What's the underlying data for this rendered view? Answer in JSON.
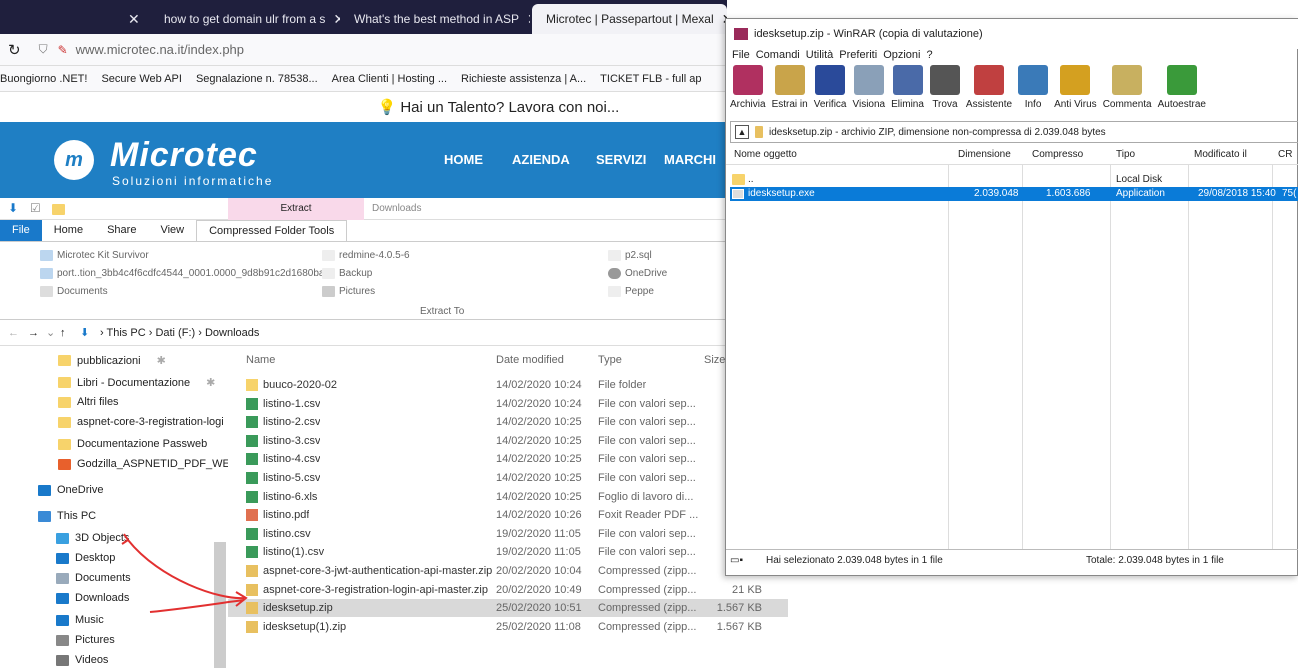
{
  "browser": {
    "tabs": [
      {
        "label": "how to get domain ulr from a s"
      },
      {
        "label": "What's the best method in ASP"
      },
      {
        "label": "Microtec | Passepartout | Mexal"
      }
    ],
    "url": "www.microtec.na.it/index.php",
    "bookmarks": [
      "Buongiorno .NET!",
      "Secure Web API",
      "Segnalazione n. 78538...",
      "Area Clienti | Hosting ...",
      "Richieste assistenza | A...",
      "TICKET FLB - full ap"
    ]
  },
  "site": {
    "banner": "Hai un Talento? Lavora con noi...",
    "logo_mark": "m",
    "logo_text": "Microtec",
    "logo_sub": "Soluzioni informatiche",
    "nav": [
      "HOME",
      "AZIENDA",
      "SERVIZI",
      "MARCHI"
    ]
  },
  "explorer": {
    "ribbon_top": {
      "extract": "Extract",
      "downloads": "Downloads"
    },
    "tabs": [
      "File",
      "Home",
      "Share",
      "View",
      "Compressed Folder Tools"
    ],
    "ribbon_items": [
      "Microtec Kit Survivor",
      "port..tion_3bb4c4f6cdfc4544_0001.0000_9d8b91c2d1680ba8",
      "Documents",
      "redmine-4.0.5-6",
      "Backup",
      "Pictures",
      "p2.sql",
      "OneDrive",
      "Peppe"
    ],
    "extract_to": "Extract To",
    "breadcrumb": [
      "This PC",
      "Dati (F:)",
      "Downloads"
    ],
    "nav_items": [
      "pubblicazioni",
      "Libri - Documentazione",
      "Altri files",
      "aspnet-core-3-registration-logi",
      "Documentazione Passweb",
      "Godzilla_ASPNETID_PDF_WEBA",
      "OneDrive",
      "This PC",
      "3D Objects",
      "Desktop",
      "Documents",
      "Downloads",
      "Music",
      "Pictures",
      "Videos"
    ],
    "columns": [
      "Name",
      "Date modified",
      "Type",
      "Size"
    ],
    "files": [
      {
        "name": "buuco-2020-02",
        "date": "14/02/2020 10:24",
        "type": "File folder",
        "size": ""
      },
      {
        "name": "listino-1.csv",
        "date": "14/02/2020 10:24",
        "type": "File con valori sep...",
        "size": ""
      },
      {
        "name": "listino-2.csv",
        "date": "14/02/2020 10:25",
        "type": "File con valori sep...",
        "size": ""
      },
      {
        "name": "listino-3.csv",
        "date": "14/02/2020 10:25",
        "type": "File con valori sep...",
        "size": ""
      },
      {
        "name": "listino-4.csv",
        "date": "14/02/2020 10:25",
        "type": "File con valori sep...",
        "size": ""
      },
      {
        "name": "listino-5.csv",
        "date": "14/02/2020 10:25",
        "type": "File con valori sep...",
        "size": ""
      },
      {
        "name": "listino-6.xls",
        "date": "14/02/2020 10:25",
        "type": "Foglio di lavoro di...",
        "size": ""
      },
      {
        "name": "listino.pdf",
        "date": "14/02/2020 10:26",
        "type": "Foxit Reader PDF ...",
        "size": ""
      },
      {
        "name": "listino.csv",
        "date": "19/02/2020 11:05",
        "type": "File con valori sep...",
        "size": ""
      },
      {
        "name": "listino(1).csv",
        "date": "19/02/2020 11:05",
        "type": "File con valori sep...",
        "size": ""
      },
      {
        "name": "aspnet-core-3-jwt-authentication-api-master.zip",
        "date": "20/02/2020 10:04",
        "type": "Compressed (zipp...",
        "size": ""
      },
      {
        "name": "aspnet-core-3-registration-login-api-master.zip",
        "date": "20/02/2020 10:49",
        "type": "Compressed (zipp...",
        "size": "21 KB"
      },
      {
        "name": "idesksetup.zip",
        "date": "25/02/2020 10:51",
        "type": "Compressed (zipp...",
        "size": "1.567 KB"
      },
      {
        "name": "idesksetup(1).zip",
        "date": "25/02/2020 11:08",
        "type": "Compressed (zipp...",
        "size": "1.567 KB"
      }
    ]
  },
  "winrar": {
    "title": "idesksetup.zip - WinRAR (copia di valutazione)",
    "menu": [
      "File",
      "Comandi",
      "Utilità",
      "Preferiti",
      "Opzioni",
      "?"
    ],
    "tools": [
      "Archivia",
      "Estrai in",
      "Verifica",
      "Visiona",
      "Elimina",
      "Trova",
      "Assistente",
      "Info",
      "Anti Virus",
      "Commenta",
      "Autoestrae"
    ],
    "tool_colors": [
      "#b03060",
      "#c9a44a",
      "#2a4a9a",
      "#8aa0b8",
      "#4a6aa8",
      "#555555",
      "#c04040",
      "#3a7ab8",
      "#d4a020",
      "#c8b060",
      "#3a9a3a"
    ],
    "path": "idesksetup.zip - archivio ZIP, dimensione non-compressa di 2.039.048 bytes",
    "columns": [
      "Nome oggetto",
      "Dimensione",
      "Compresso",
      "Tipo",
      "Modificato il",
      "CR"
    ],
    "rows": [
      {
        "name": "..",
        "size": "",
        "packed": "",
        "type": "Local Disk",
        "modified": ""
      },
      {
        "name": "idesksetup.exe",
        "size": "2.039.048",
        "packed": "1.603.686",
        "type": "Application",
        "modified": "29/08/2018 15:40",
        "crc": "75("
      }
    ],
    "status_left": "Hai selezionato 2.039.048 bytes in 1 file",
    "status_right": "Totale: 2.039.048 bytes in 1 file"
  }
}
